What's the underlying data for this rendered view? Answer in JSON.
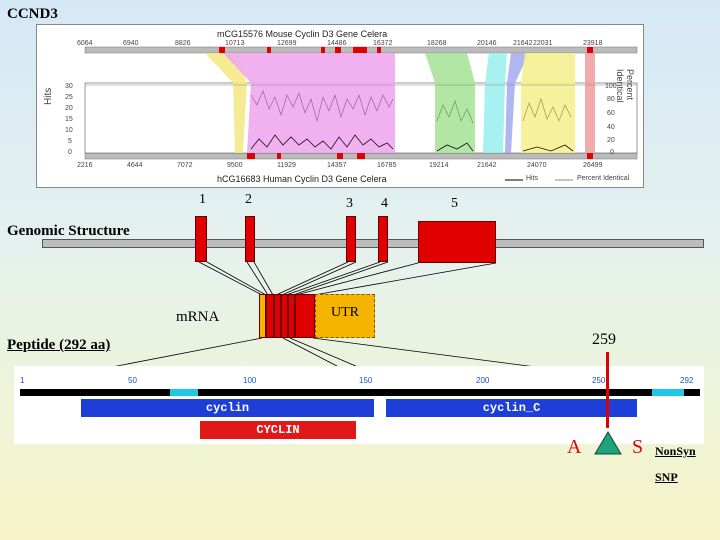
{
  "page_title": "CCND3",
  "alignment": {
    "top_title": "mCG15576 Mouse Cyclin D3 Gene Celera",
    "bottom_title": "hCG16683 Human Cyclin D3 Gene Celera",
    "top_ticks": [
      "6064",
      "6940",
      "8826",
      "10713",
      "12699",
      "14486",
      "16372",
      "18268",
      "20146",
      "21642",
      "22031",
      "23918"
    ],
    "bottom_ticks": [
      "2216",
      "4644",
      "7072",
      "9500",
      "11929",
      "14357",
      "16785",
      "19214",
      "21642",
      "24070",
      "26499"
    ],
    "y_left_label": "Hits",
    "y_right_label": "Percent Identical",
    "y_left_ticks": [
      "30",
      "25",
      "20",
      "15",
      "10",
      "5",
      "0"
    ],
    "y_right_ticks": [
      "100",
      "80",
      "60",
      "40",
      "20",
      "0"
    ],
    "legend_hits": "Hits",
    "legend_percent": "Percent Identical",
    "colors": {
      "yellow": "#f5e98a",
      "magenta": "#f0a8f0",
      "green": "#a9e39a",
      "cyan": "#9eeff0",
      "blue": "#a9aef0",
      "yellow2": "#f5f190",
      "red": "#f0a2a2"
    }
  },
  "genomic": {
    "label": "Genomic Structure",
    "exon_numbers": [
      "1",
      "2",
      "3",
      "4",
      "5"
    ]
  },
  "mrna": {
    "label": "mRNA",
    "utr_label": "UTR"
  },
  "peptide": {
    "label": "Peptide (292 aa)",
    "ticks": [
      "1",
      "50",
      "100",
      "150",
      "200",
      "250",
      "292"
    ],
    "domains": [
      "cyclin",
      "cyclin_C",
      "CYCLIN"
    ],
    "highlight_colors": {
      "backbone": "#000000",
      "cyan": "#1ec8e6",
      "domain_blue": "#1e3ed8",
      "domain_red": "#e01818"
    }
  },
  "snp": {
    "position": "259",
    "ref_aa": "A",
    "alt_aa": "S",
    "type": "NonSyn",
    "label": "SNP",
    "triangle_color": "#1fa37a",
    "marker_color": "#e00000"
  }
}
